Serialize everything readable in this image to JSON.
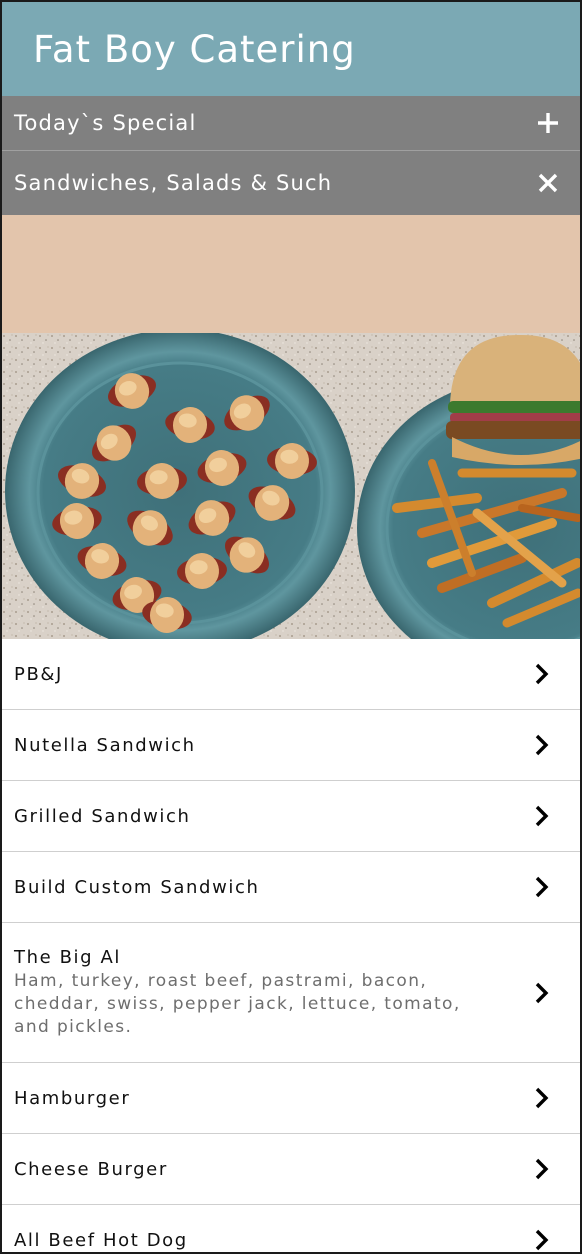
{
  "header": {
    "title": "Fat Boy Catering",
    "bg_color": "#7ba9b4"
  },
  "sections": [
    {
      "label": "Today`s Special",
      "icon": "plus-icon",
      "expanded": false
    },
    {
      "label": "Sandwiches, Salads & Such",
      "icon": "close-icon",
      "expanded": true
    }
  ],
  "banner": {
    "band_color": "#e3c5ac",
    "image": "photo of pigs in a blanket on a blue plate next to a burger with fries"
  },
  "menu": {
    "items": [
      {
        "name": "PB&J",
        "description": ""
      },
      {
        "name": "Nutella Sandwich",
        "description": ""
      },
      {
        "name": "Grilled Sandwich",
        "description": ""
      },
      {
        "name": "Build Custom Sandwich",
        "description": ""
      },
      {
        "name": "The Big Al",
        "description": "Ham, turkey, roast beef, pastrami, bacon, cheddar, swiss, pepper jack, lettuce, tomato, and pickles."
      },
      {
        "name": "Hamburger",
        "description": ""
      },
      {
        "name": "Cheese Burger",
        "description": ""
      },
      {
        "name": "All Beef Hot Dog",
        "description": ""
      }
    ],
    "item_icon": "chevron-right-icon"
  }
}
